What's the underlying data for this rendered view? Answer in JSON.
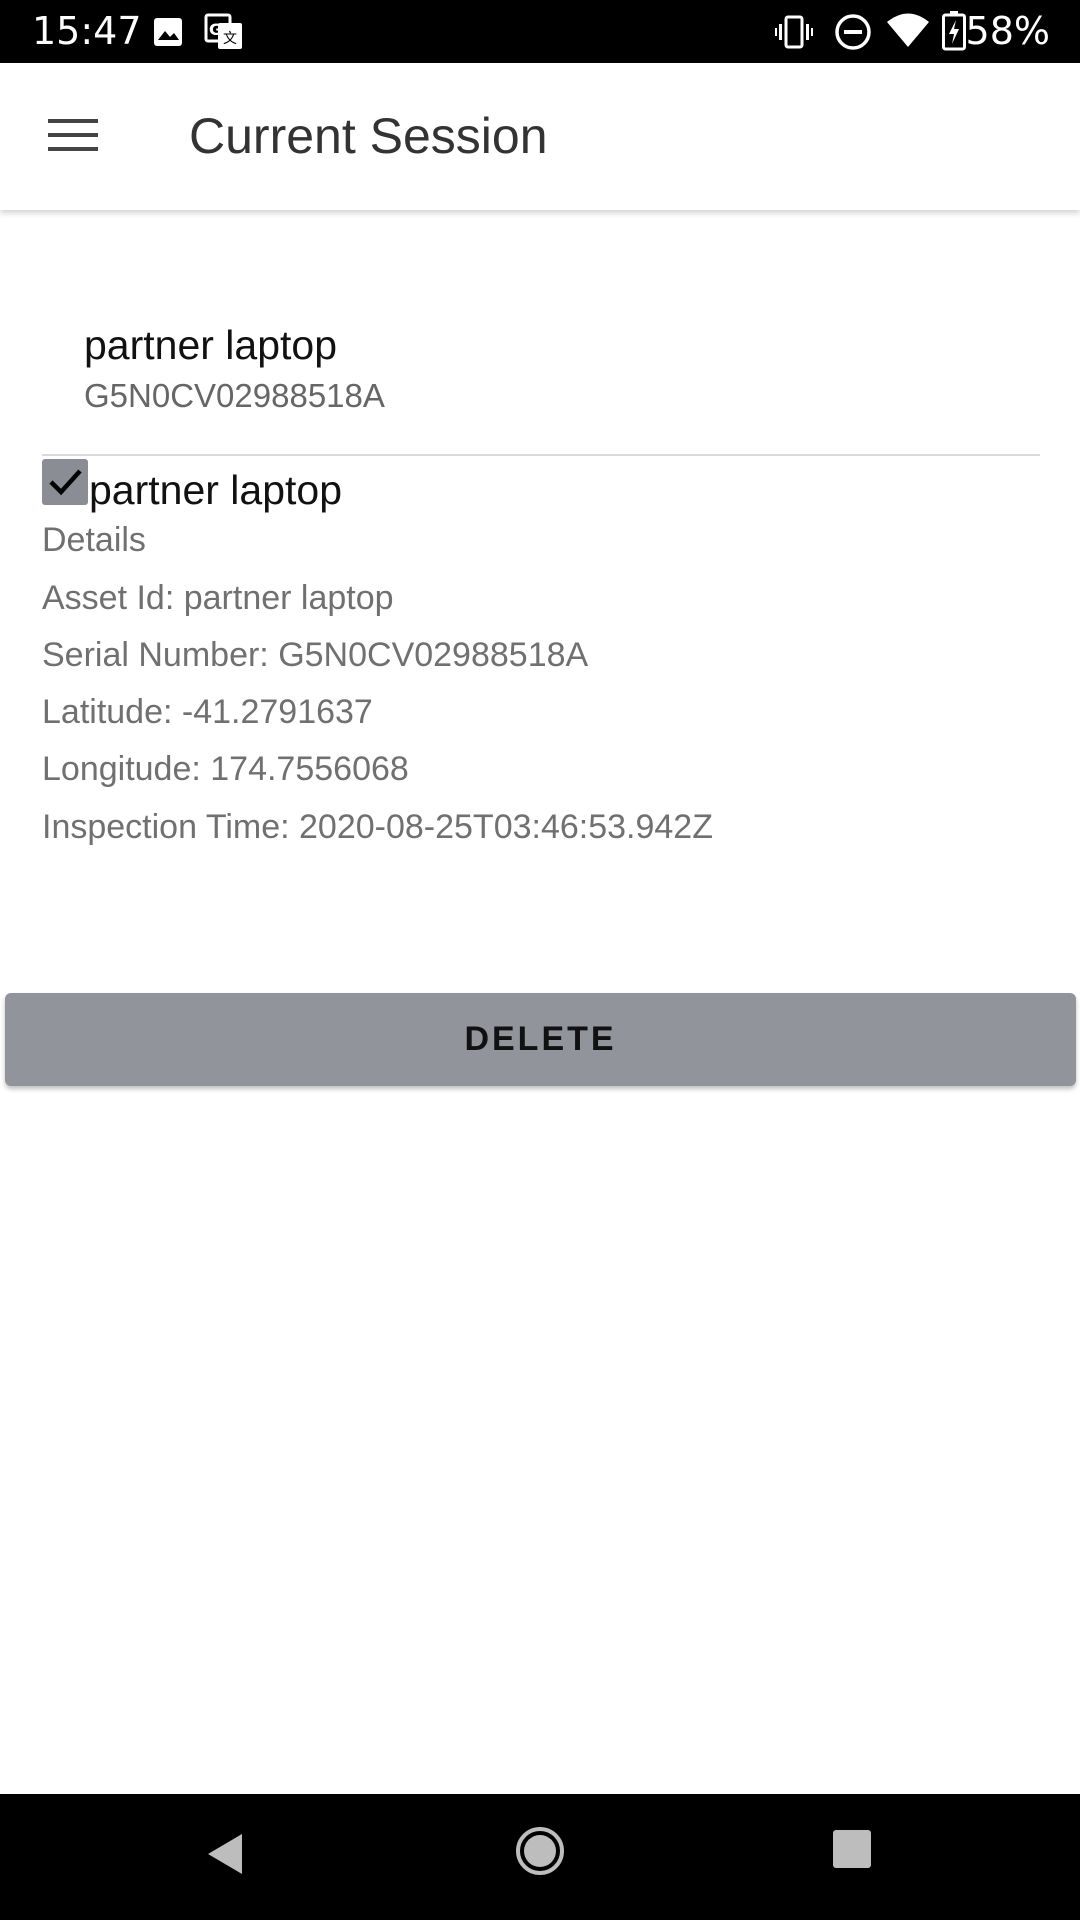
{
  "status_bar": {
    "time": "15:47",
    "battery": "58%",
    "icons": [
      "image-icon",
      "translate-icon",
      "vibrate-icon",
      "do-not-disturb-icon",
      "wifi-icon",
      "battery-charging-icon"
    ]
  },
  "app_bar": {
    "title": "Current Session",
    "menu_icon": "hamburger-menu-icon"
  },
  "list_item": {
    "title": "partner laptop",
    "subtitle": "G5N0CV02988518A"
  },
  "checkbox": {
    "checked": true,
    "label": "partner laptop"
  },
  "details": {
    "heading": "Details",
    "asset_id": "Asset Id: partner laptop",
    "serial_number": "Serial Number: G5N0CV02988518A",
    "latitude": "Latitude: -41.2791637",
    "longitude": "Longitude: 174.7556068",
    "inspection_time": "Inspection Time: 2020-08-25T03:46:53.942Z"
  },
  "actions": {
    "delete_label": "DELETE"
  },
  "nav_bar": {
    "icons": [
      "back-icon",
      "home-icon",
      "recents-icon"
    ]
  },
  "colors": {
    "button_bg": "#91949b",
    "checkbox_bg": "#8a8d94",
    "title_text": "#333333",
    "secondary_text": "#707070"
  }
}
